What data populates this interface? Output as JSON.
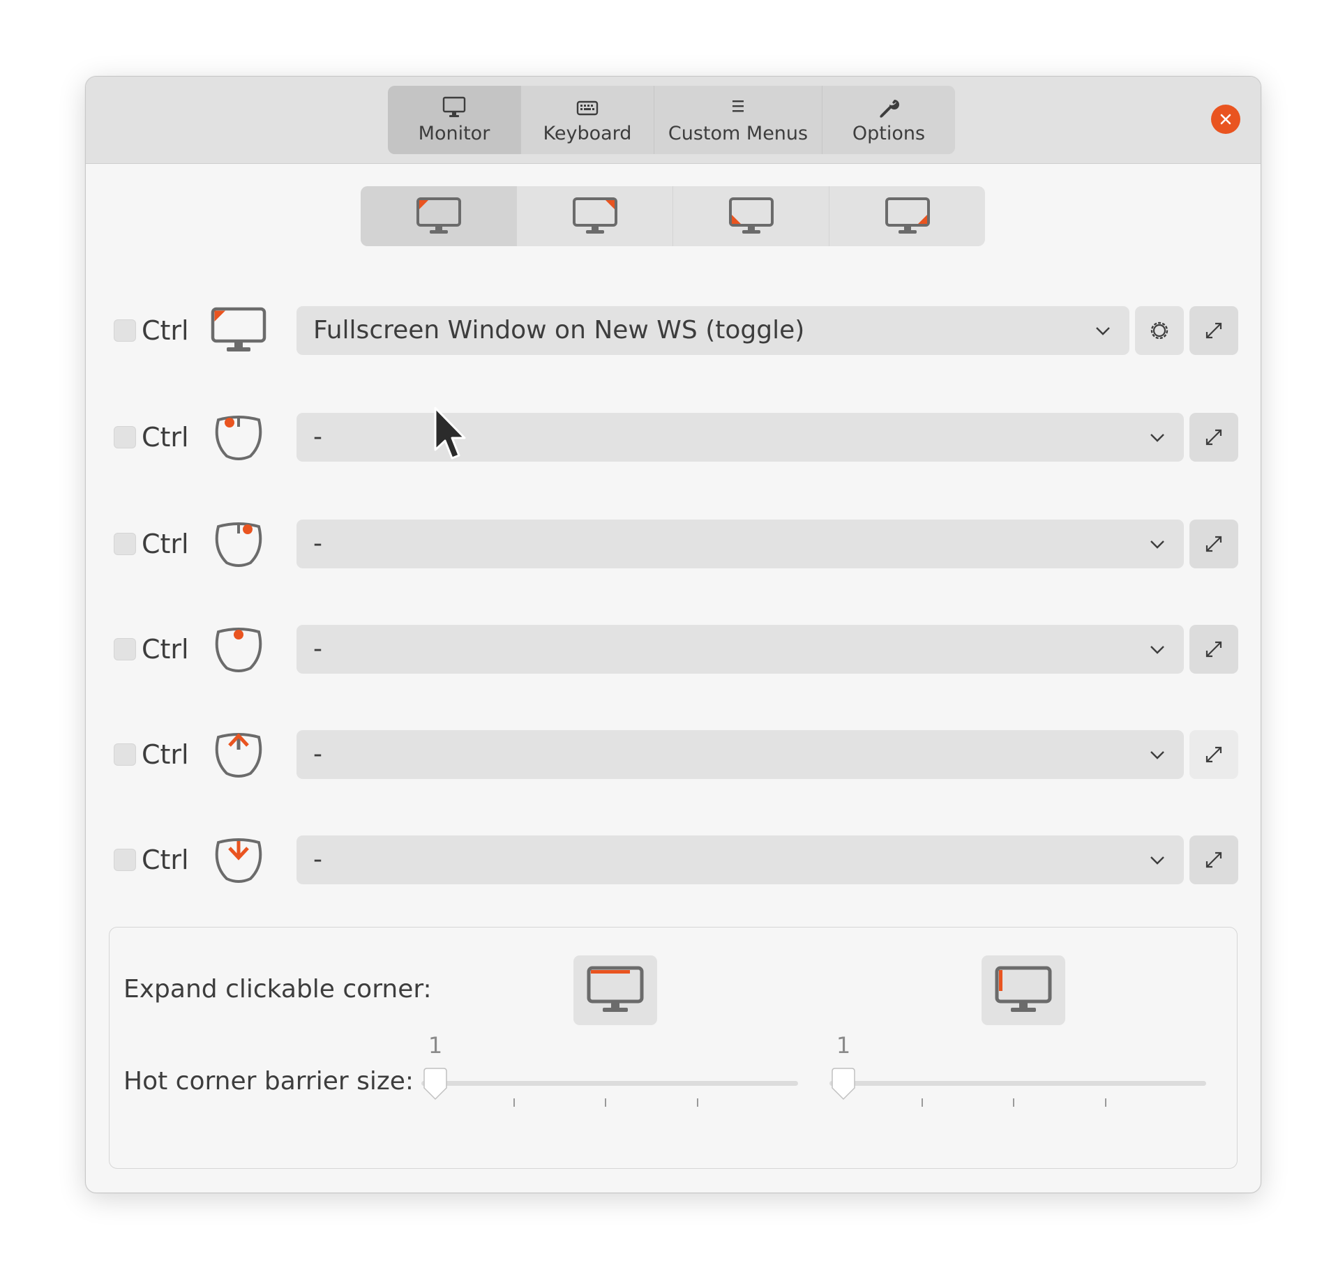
{
  "window": {
    "tabs": [
      {
        "label": "Monitor",
        "icon": "monitor-icon",
        "active": true
      },
      {
        "label": "Keyboard",
        "icon": "keyboard-icon",
        "active": false
      },
      {
        "label": "Custom Menus",
        "icon": "menu-list-icon",
        "active": false
      },
      {
        "label": "Options",
        "icon": "wrench-icon",
        "active": false
      }
    ],
    "close_icon": "close-icon",
    "accent_color": "#e95420"
  },
  "corner_tabs": [
    {
      "name": "top-left-corner",
      "active": true
    },
    {
      "name": "top-right-corner",
      "active": false
    },
    {
      "name": "bottom-left-corner",
      "active": false
    },
    {
      "name": "bottom-right-corner",
      "active": false
    }
  ],
  "trigger_rows": [
    {
      "trigger": "monitor-corner-hotcorner",
      "ctrl_label": "Ctrl",
      "action": "Fullscreen Window on New WS (toggle)",
      "has_settings": true
    },
    {
      "trigger": "mouse-primary-button",
      "ctrl_label": "Ctrl",
      "action": "-",
      "has_settings": false
    },
    {
      "trigger": "mouse-secondary-button",
      "ctrl_label": "Ctrl",
      "action": "-",
      "has_settings": false
    },
    {
      "trigger": "mouse-middle-button",
      "ctrl_label": "Ctrl",
      "action": "-",
      "has_settings": false
    },
    {
      "trigger": "mouse-scroll-up",
      "ctrl_label": "Ctrl",
      "action": "-",
      "has_settings": false
    },
    {
      "trigger": "mouse-scroll-down",
      "ctrl_label": "Ctrl",
      "action": "-",
      "has_settings": false
    }
  ],
  "corner_settings": {
    "expand_label": "Expand clickable corner:",
    "barrier_label": "Hot corner barrier size:",
    "horizontal_barrier_value": "1",
    "vertical_barrier_value": "1"
  }
}
